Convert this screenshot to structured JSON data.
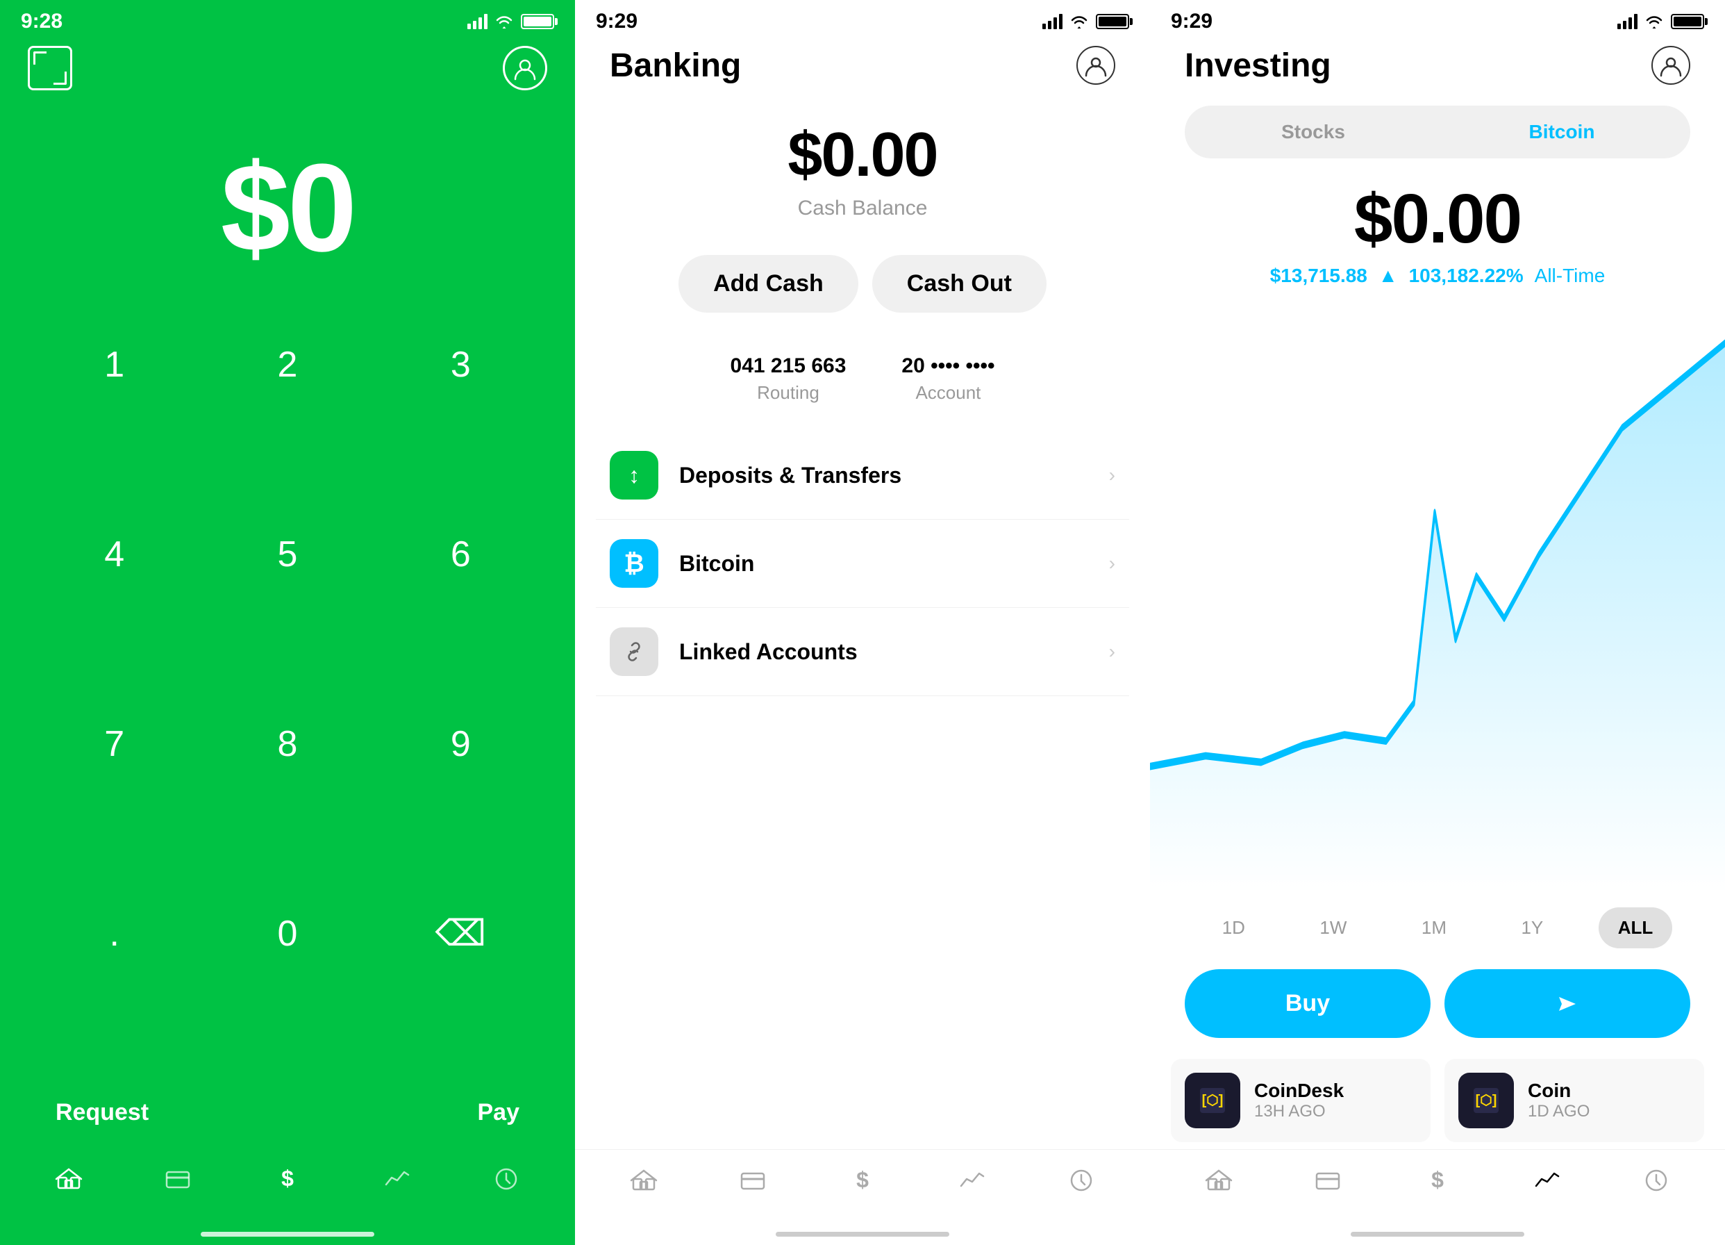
{
  "screen1": {
    "time": "9:28",
    "amount": "$0",
    "numpad": [
      "1",
      "2",
      "3",
      "4",
      "5",
      "6",
      "7",
      "8",
      "9",
      ".",
      "0",
      "⌫"
    ],
    "request_label": "Request",
    "pay_label": "Pay",
    "tabs": [
      "home",
      "card",
      "dollar",
      "chart",
      "clock"
    ]
  },
  "screen2": {
    "time": "9:29",
    "title": "Banking",
    "balance": "$0.00",
    "balance_label": "Cash Balance",
    "add_cash_label": "Add Cash",
    "cash_out_label": "Cash Out",
    "routing_value": "041 215 663",
    "routing_label": "Routing",
    "account_value": "20 •••• ••••",
    "account_label": "Account",
    "menu_items": [
      {
        "label": "Deposits & Transfers",
        "icon": "↕",
        "color": "green"
      },
      {
        "label": "Bitcoin",
        "icon": "₿",
        "color": "blue"
      },
      {
        "label": "Linked Accounts",
        "icon": "🔗",
        "color": "gray"
      }
    ]
  },
  "screen3": {
    "time": "9:29",
    "title": "Investing",
    "tab_stocks": "Stocks",
    "tab_bitcoin": "Bitcoin",
    "balance": "$0.00",
    "price": "$13,715.88",
    "change": "103,182.22%",
    "period": "All-Time",
    "time_periods": [
      "1D",
      "1W",
      "1M",
      "1Y",
      "ALL"
    ],
    "active_period": "ALL",
    "buy_label": "Buy",
    "send_label": "Send",
    "news_source": "CoinDesk",
    "news_time": "13H AGO",
    "news_source2": "Coin",
    "news_time2": "1D AGO"
  }
}
